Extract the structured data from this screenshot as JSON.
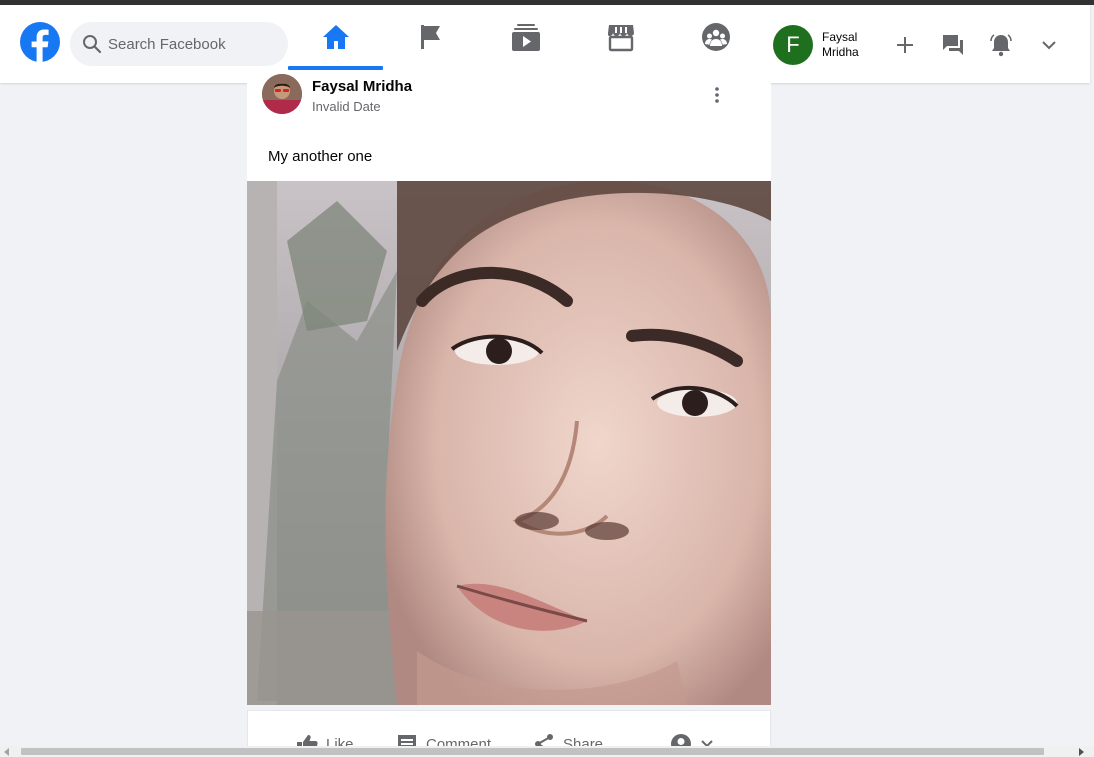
{
  "header": {
    "search_placeholder": "Search Facebook",
    "nav_tabs": [
      {
        "name": "home",
        "icon": "home-icon",
        "active": true
      },
      {
        "name": "pages",
        "icon": "flag-icon",
        "active": false
      },
      {
        "name": "watch",
        "icon": "video-icon",
        "active": false
      },
      {
        "name": "marketplace",
        "icon": "store-icon",
        "active": false
      },
      {
        "name": "groups",
        "icon": "groups-icon",
        "active": false
      }
    ],
    "profile": {
      "initial": "F",
      "name": "Faysal Mridha"
    },
    "actions": [
      {
        "name": "create",
        "icon": "plus-icon"
      },
      {
        "name": "messenger",
        "icon": "chat-icon"
      },
      {
        "name": "notifications",
        "icon": "bell-icon"
      },
      {
        "name": "account",
        "icon": "chevron-down-icon"
      }
    ]
  },
  "post": {
    "author": "Faysal Mridha",
    "date": "Invalid Date",
    "text": "My another one"
  },
  "post_actions": {
    "like": "Like",
    "comment": "Comment",
    "share": "Share"
  },
  "colors": {
    "brand": "#1877f2",
    "background": "#f0f2f5",
    "avatar_green": "#1e6f1e",
    "secondary_text": "#65676b"
  }
}
